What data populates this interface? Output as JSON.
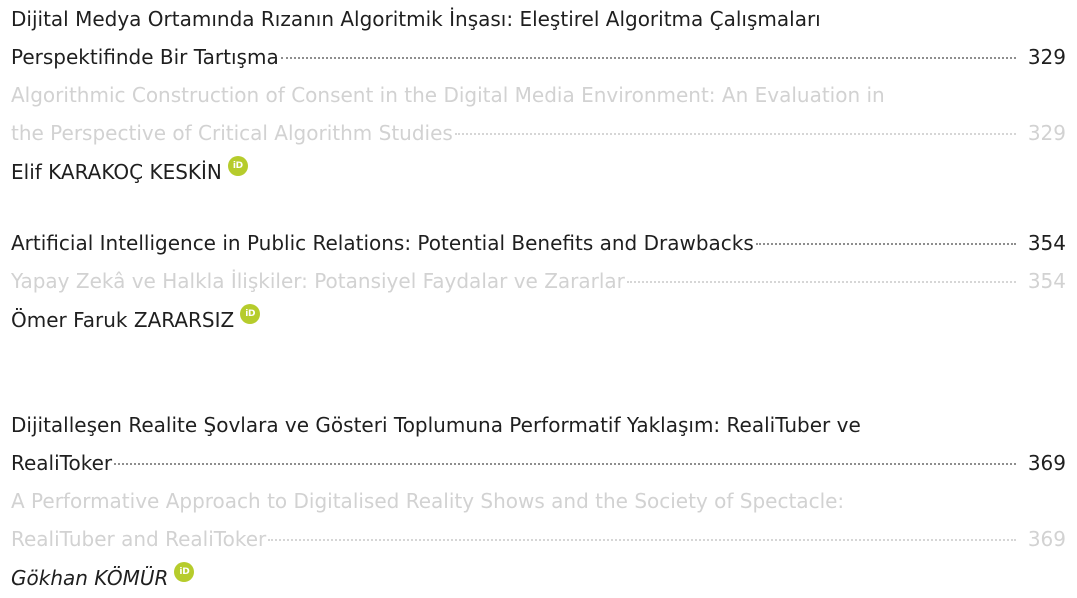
{
  "icons": {
    "orcid": "orcid-icon",
    "orcid_glyph": "iD",
    "orcid_color": "#b6cc2c"
  },
  "colors": {
    "primary_text": "#1f1f1f",
    "secondary_text": "#d2d2d2"
  },
  "entries": [
    {
      "title_line1": "Dijital Medya Ortamında Rızanın Algoritmik İnşası: Eleştirel Algoritma Çalışmaları",
      "title_line2": "Perspektifinde Bir Tartışma",
      "title_page": "329",
      "translation_line1": "Algorithmic Construction of Consent in the Digital Media Environment: An Evaluation in",
      "translation_line2": "the Perspective of Critical Algorithm Studies",
      "translation_page": "329",
      "author": "Elif KARAKOÇ KESKİN"
    },
    {
      "title_line1": "Artificial Intelligence in Public Relations: Potential Benefits and Drawbacks",
      "title_page": "354",
      "translation_line1": "Yapay Zekâ ve Halkla İlişkiler: Potansiyel Faydalar ve Zararlar",
      "translation_page": "354",
      "author": "Ömer Faruk ZARARSIZ"
    },
    {
      "title_line1": "Dijitalleşen Realite Şovlara ve Gösteri Toplumuna Performatif Yaklaşım: RealiTuber ve",
      "title_line2": "RealiToker",
      "title_page": "369",
      "translation_line1": "A Performative Approach to Digitalised Reality Shows and the Society of Spectacle:",
      "translation_line2": "RealiTuber and RealiToker",
      "translation_page": "369",
      "author": "Gökhan KÖMÜR"
    }
  ]
}
